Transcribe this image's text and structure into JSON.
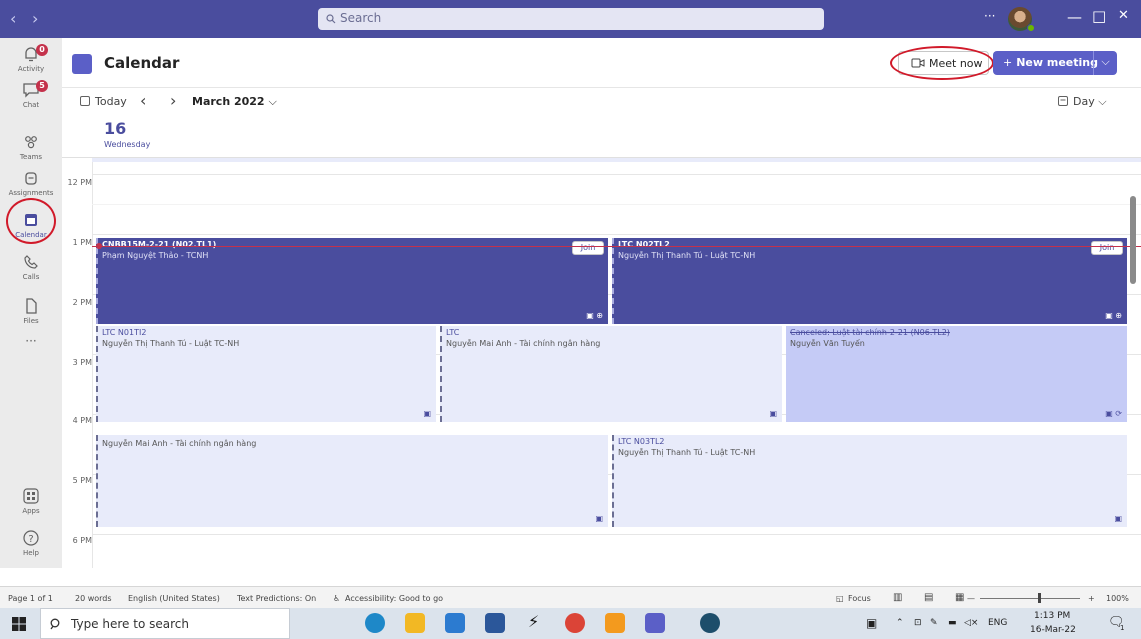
{
  "titlebar": {
    "back": "‹",
    "forward": "›",
    "search_placeholder": "Search",
    "more": "···",
    "minimize": "—",
    "maximize": "□",
    "close": "✕"
  },
  "rail": [
    {
      "label": "Activity",
      "icon": "bell-icon",
      "badge": "0"
    },
    {
      "label": "Chat",
      "icon": "chat-icon",
      "badge": "5"
    },
    {
      "label": "Teams",
      "icon": "teams-icon",
      "badge": ""
    },
    {
      "label": "Assignments",
      "icon": "assignments-icon",
      "badge": ""
    },
    {
      "label": "Calendar",
      "icon": "calendar-icon",
      "badge": "",
      "active": true
    },
    {
      "label": "Calls",
      "icon": "phone-icon",
      "badge": ""
    },
    {
      "label": "Files",
      "icon": "file-icon",
      "badge": ""
    },
    {
      "label": "···",
      "icon": "more-icon",
      "badge": ""
    }
  ],
  "rail_bottom": [
    {
      "label": "Apps",
      "icon": "apps-icon"
    },
    {
      "label": "Help",
      "icon": "help-icon"
    }
  ],
  "header": {
    "title": "Calendar",
    "meet_now": "Meet now",
    "new_meeting": "New meeting"
  },
  "toolbar": {
    "today": "Today",
    "prev": "‹",
    "next": "›",
    "month": "March 2022",
    "view": "Day"
  },
  "day": {
    "number": "16",
    "name": "Wednesday"
  },
  "hours": [
    "12 PM",
    "1 PM",
    "2 PM",
    "3 PM",
    "4 PM",
    "5 PM",
    "6 PM"
  ],
  "events": [
    {
      "subject": "CNBB15M-2-21 (N02.TL1)",
      "organizer": "Phạm Nguyệt Thảo - TCNH",
      "join": "Join",
      "style": "dark"
    },
    {
      "subject": "LTC N02TL2",
      "organizer": "Nguyễn Thị Thanh Tú - Luật TC-NH",
      "join": "Join",
      "style": "dark"
    },
    {
      "subject": "LTC N01TI2",
      "organizer": "Nguyễn Thị Thanh Tú - Luật TC-NH",
      "join": "",
      "style": "light"
    },
    {
      "subject": "LTC",
      "organizer": "Nguyễn Mai Anh - Tài chính ngân hàng",
      "join": "",
      "style": "light"
    },
    {
      "subject": "Canceled: Luật tài chính-2-21 (N06.TL2)",
      "organizer": "Nguyễn Văn Tuyến",
      "join": "",
      "style": "mid"
    },
    {
      "subject": "",
      "organizer": "Nguyễn Mai Anh - Tài chính ngân hàng",
      "join": "",
      "style": "light"
    },
    {
      "subject": "LTC N03TL2",
      "organizer": "Nguyễn Thị Thanh Tú - Luật TC-NH",
      "join": "",
      "style": "light"
    }
  ],
  "statusbar": {
    "page": "Page 1 of 1",
    "words": "20 words",
    "language": "English (United States)",
    "predictions": "Text Predictions: On",
    "accessibility": "Accessibility: Good to go",
    "focus": "Focus",
    "zoom_minus": "—",
    "zoom_plus": "+",
    "zoom": "100%"
  },
  "taskbar": {
    "search_placeholder": "Type here to search",
    "lang": "ENG",
    "time": "1:13 PM",
    "date": "16-Mar-22",
    "notif": "1"
  },
  "colors": {
    "brand": "#4a4d9e",
    "accent": "#5b5fc7",
    "annotation": "#d11a2a"
  }
}
